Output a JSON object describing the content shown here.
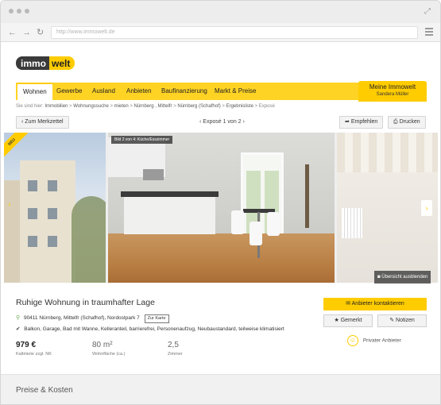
{
  "browser": {
    "url": "http://www.immowelt.de",
    "back_icon": "arrow-left-icon",
    "forward_icon": "arrow-right-icon",
    "reload_icon": "reload-icon",
    "menu_icon": "hamburger-menu-icon",
    "maximize_icon": "expand-icon"
  },
  "logo": {
    "part1": "immo",
    "part2": "welt"
  },
  "nav": {
    "items": [
      "Wohnen",
      "Gewerbe",
      "Ausland",
      "Anbieten",
      "Baufinanzierung",
      "Markt & Preise"
    ],
    "active": "Wohnen",
    "my_immowelt": "Meine Immowelt",
    "user": "Sandera Müller"
  },
  "breadcrumb": {
    "prefix": "Sie sind hier:",
    "items": [
      "Immobilien",
      "Wohnungssuche",
      "mieten",
      "Nürnberg , Mittelfr",
      "Nürnberg (Schafhof)",
      "Ergebnisliste",
      "Exposé"
    ]
  },
  "toolbar": {
    "back_label": "Zum Merkzettel",
    "counter": "Exposé 1 von 2",
    "recommend_label": "Empfehlen",
    "print_label": "Drucken"
  },
  "gallery": {
    "ribbon": "NEU",
    "caption": "Bild 2 von 4: Küche/Esszimmer",
    "overview_label": "Übersicht ausblenden"
  },
  "listing": {
    "title": "Ruhige Wohnung in traumhafter Lage",
    "address": "90411 Nürnberg, Mittelfr (Schafhof), Nordostpark 7",
    "map_label": "Zur Karte",
    "features": "Balkon, Garage, Bad mit Wanne, Kelleranteil, barrierefrei, Personenaufzug, Neubaustandard, teilweise klimatisiert",
    "facts": [
      {
        "value": "979 €",
        "label": "Kaltmiete zzgl. NK"
      },
      {
        "value": "80 m²",
        "label": "Wohnfläche (ca.)"
      },
      {
        "value": "2,5",
        "label": "Zimmer"
      }
    ]
  },
  "actions": {
    "contact_label": "Anbieter kontaktieren",
    "saved_label": "Gemerkt",
    "notes_label": "Notizen",
    "provider_label": "Privater Anbieter"
  },
  "section": {
    "title": "Preise & Kosten"
  },
  "colors": {
    "brand_yellow": "#ffcc00",
    "nav_yellow": "#ffd324",
    "dark": "#3a3a3a"
  }
}
